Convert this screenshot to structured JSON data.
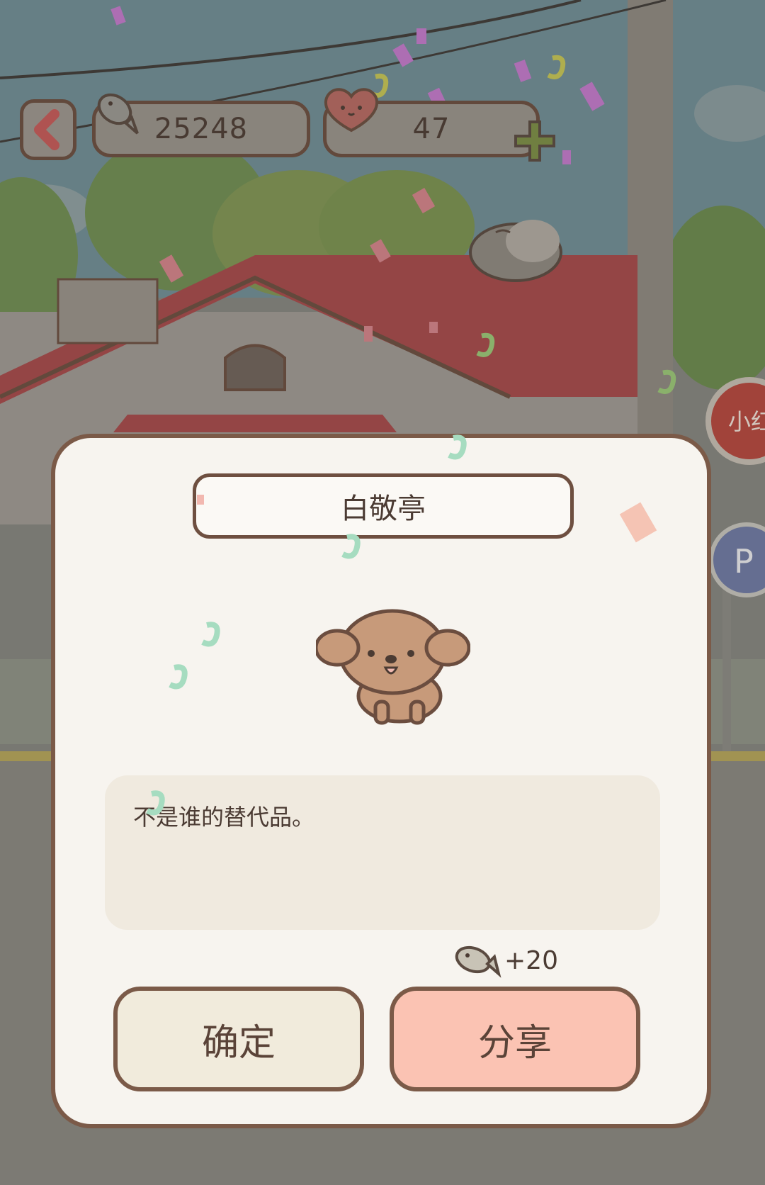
{
  "hud": {
    "fish_count": "25248",
    "heart_count": "47"
  },
  "dialog": {
    "character_name": "白敬亭",
    "description": "不是谁的替代品。",
    "reward_text": "+20",
    "confirm_label": "确定",
    "share_label": "分享"
  },
  "signs": {
    "parking_letter": "P",
    "red_sign_text": "小红"
  },
  "colors": {
    "outline": "#7b5a48",
    "dialog_bg": "#f7f4ef",
    "share_button": "#fbc3b3",
    "confirm_button": "#f1ebdc",
    "roof": "#a8484a",
    "sky": "#6f8f98"
  },
  "icons": [
    "back-arrow-icon",
    "fish-icon",
    "heart-face-icon",
    "plus-icon",
    "dog-character",
    "cat-on-roof"
  ]
}
